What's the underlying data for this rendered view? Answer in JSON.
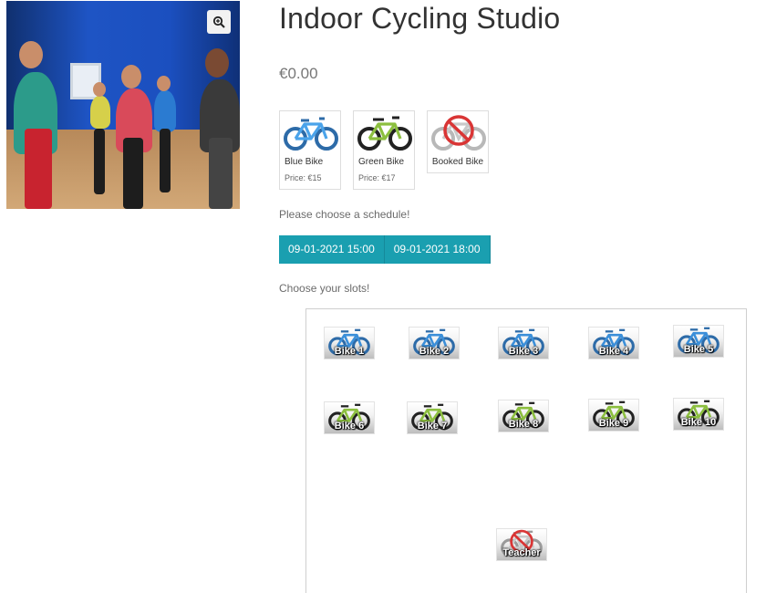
{
  "product": {
    "title": "Indoor Cycling Studio",
    "price": "€0.00"
  },
  "icons": {
    "zoom": "magnifier-plus-icon"
  },
  "legend": [
    {
      "name": "Blue Bike",
      "price": "Price: €15",
      "color": "#3b8fd9"
    },
    {
      "name": "Green Bike",
      "price": "Price: €17",
      "color": "#8cbf3f"
    },
    {
      "name": "Booked Bike",
      "price": "",
      "color": "#d93535"
    }
  ],
  "schedule": {
    "prompt": "Please choose a schedule!",
    "options": [
      "09-01-2021 15:00",
      "09-01-2021 18:00"
    ],
    "accent": "#1a9fb0"
  },
  "slots": {
    "prompt": "Choose your slots!",
    "items": [
      {
        "label": "Bike 1",
        "type": "blue"
      },
      {
        "label": "Bike 2",
        "type": "blue"
      },
      {
        "label": "Bike 3",
        "type": "blue"
      },
      {
        "label": "Bike 4",
        "type": "blue"
      },
      {
        "label": "Bike 5",
        "type": "blue"
      },
      {
        "label": "Bike 6",
        "type": "green"
      },
      {
        "label": "Bike 7",
        "type": "green"
      },
      {
        "label": "Bike 8",
        "type": "green"
      },
      {
        "label": "Bike 9",
        "type": "green"
      },
      {
        "label": "Bike 10",
        "type": "green"
      },
      {
        "label": "Teacher",
        "type": "booked"
      }
    ]
  }
}
